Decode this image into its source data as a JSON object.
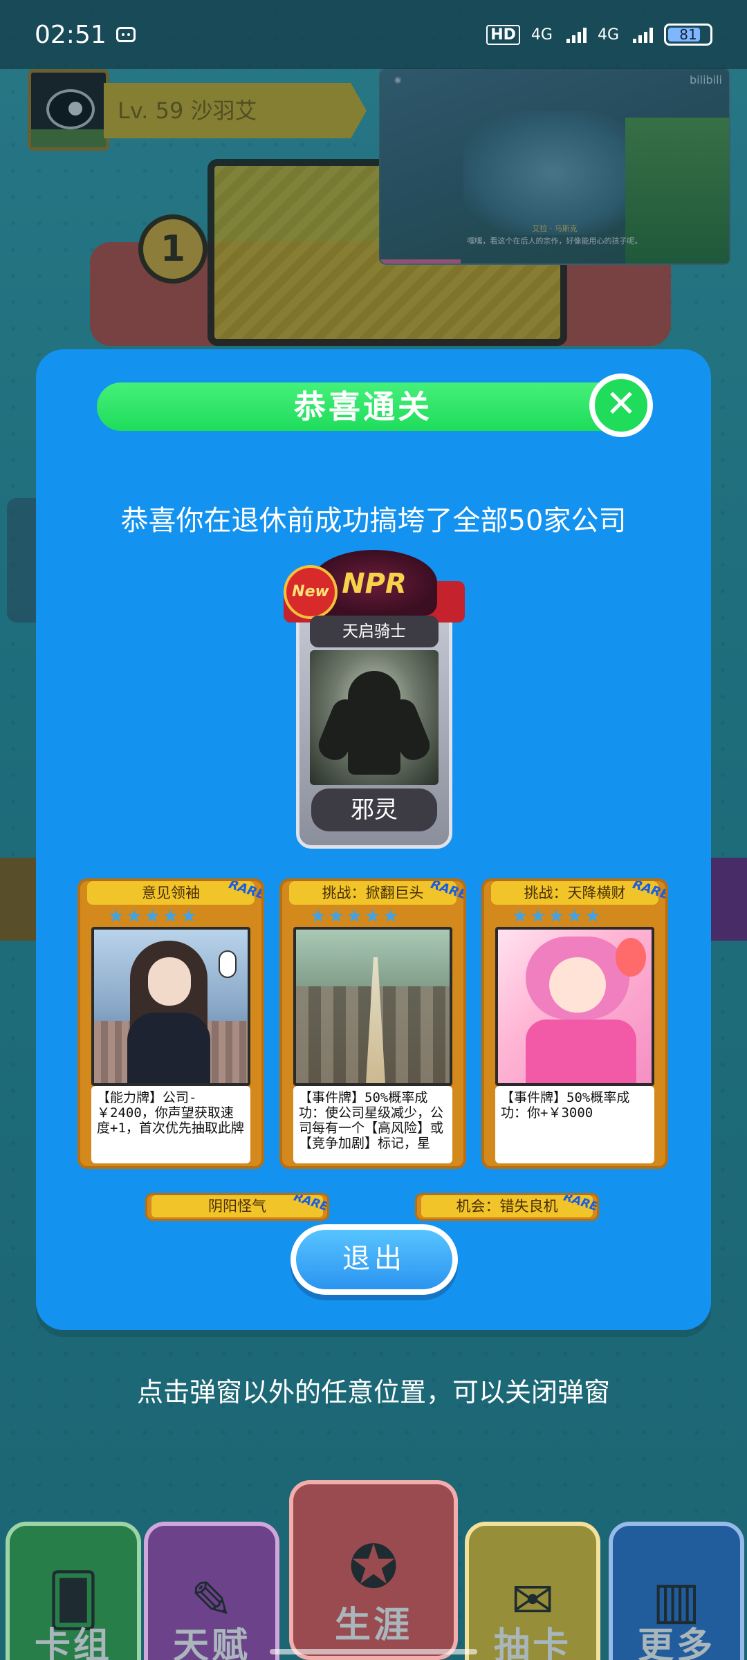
{
  "status_bar": {
    "time": "02:51",
    "hd_label": "HD",
    "sim1_label": "4G",
    "sim2_label": "4G",
    "battery": "81"
  },
  "player": {
    "level_text": "Lv. 59 沙羽艾"
  },
  "pip_video": {
    "brand": "bilibili",
    "speaker": "艾拉 · 马斯克",
    "subtitle": "嘿嘿，看这个在后人的宗作，好像能用心的孩子呢。",
    "progress_percent": 23
  },
  "modal": {
    "title": "恭喜通关",
    "close_symbol": "✕",
    "message": "恭喜你在退休前成功搞垮了全部50家公司",
    "reward_card": {
      "badge": "New",
      "rarity": "NPR",
      "subtitle": "天启骑士",
      "name": "邪灵"
    },
    "cards": [
      {
        "title": "意见领袖",
        "rare": "RARE",
        "stars": "★★★★★",
        "desc": "【能力牌】公司-￥2400，你声望获取速度+1，首次优先抽取此牌"
      },
      {
        "title": "挑战：掀翻巨头",
        "rare": "RARE",
        "stars": "★★★★★",
        "desc": "【事件牌】50%概率成功：使公司星级减少，公司每有一个【高风险】或【竞争加剧】标记，星"
      },
      {
        "title": "挑战：天降横财",
        "rare": "RARE",
        "stars": "★★★★★",
        "desc": "【事件牌】50%概率成功：你+￥3000"
      }
    ],
    "tags": [
      {
        "label": "阴阳怪气",
        "rare": "RARE"
      },
      {
        "label": "机会：错失良机",
        "rare": "RARE"
      }
    ],
    "exit_label": "退出"
  },
  "close_hint": "点击弹窗以外的任意位置，可以关闭弹窗",
  "bottom_nav": [
    {
      "label": "卡组",
      "icon": "cards-icon"
    },
    {
      "label": "天赋",
      "icon": "scroll-icon"
    },
    {
      "label": "生涯",
      "icon": "medal-icon"
    },
    {
      "label": "抽卡",
      "icon": "ticket-icon"
    },
    {
      "label": "更多",
      "icon": "chart-icon"
    }
  ],
  "colors": {
    "modal_bg": "#1392f0",
    "title_bar": "#1fdc5b",
    "card_gold": "#d3891c"
  }
}
